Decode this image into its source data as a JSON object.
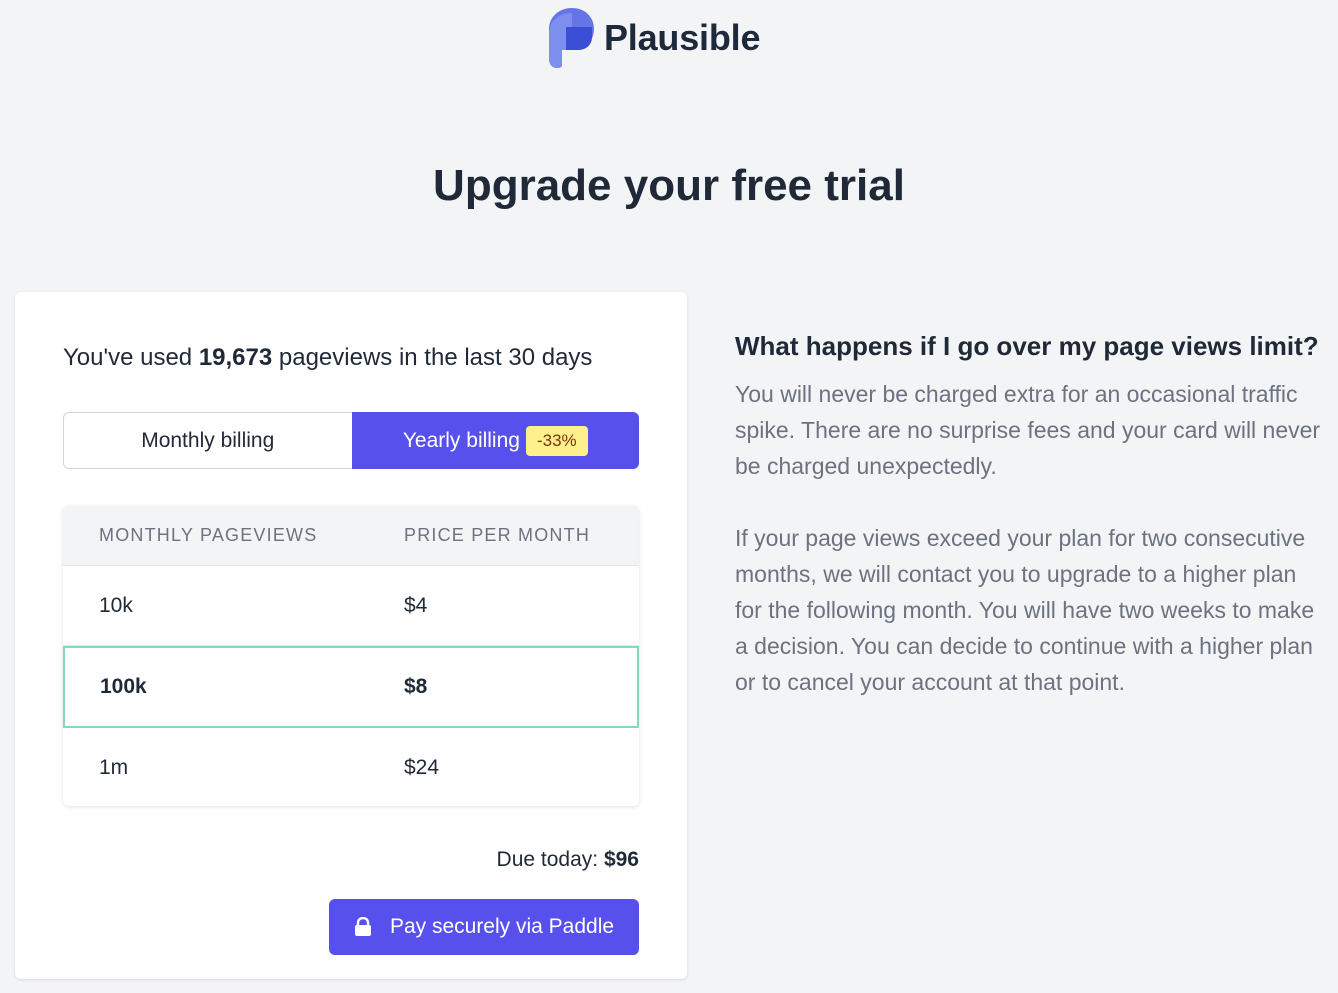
{
  "brand": {
    "name": "Plausible",
    "logo_icon": "plausible-logo",
    "accent_color": "#5850ec",
    "logo_colors": [
      "#5f74e6",
      "#8193f0",
      "#4b5fd8"
    ]
  },
  "headline": "Upgrade your free trial",
  "usage": {
    "prefix": "You've used ",
    "pageviews": "19,673",
    "suffix": " pageviews in the last 30 days"
  },
  "billing_toggle": {
    "monthly_label": "Monthly billing",
    "yearly_label": "Yearly billing",
    "yearly_discount": "-33%",
    "selected": "yearly"
  },
  "plans": {
    "headers": [
      "MONTHLY PAGEVIEWS",
      "PRICE PER MONTH"
    ],
    "rows": [
      {
        "pageviews": "10k",
        "price": "$4",
        "selected": false
      },
      {
        "pageviews": "100k",
        "price": "$8",
        "selected": true
      },
      {
        "pageviews": "1m",
        "price": "$24",
        "selected": false
      }
    ]
  },
  "due": {
    "label": "Due today: ",
    "amount": "$96"
  },
  "pay_button": {
    "label": "Pay securely via Paddle",
    "icon": "lock-icon"
  },
  "faq": {
    "question": "What happens if I go over my page views limit?",
    "answer_1": "You will never be charged extra for an occasional traffic spike. There are no surprise fees and your card will never be charged unexpectedly.",
    "answer_2": "If your page views exceed your plan for two consecutive months, we will contact you to upgrade to a higher plan for the following month. You will have two weeks to make a decision. You can decide to continue with a higher plan or to cancel your account at that point."
  }
}
